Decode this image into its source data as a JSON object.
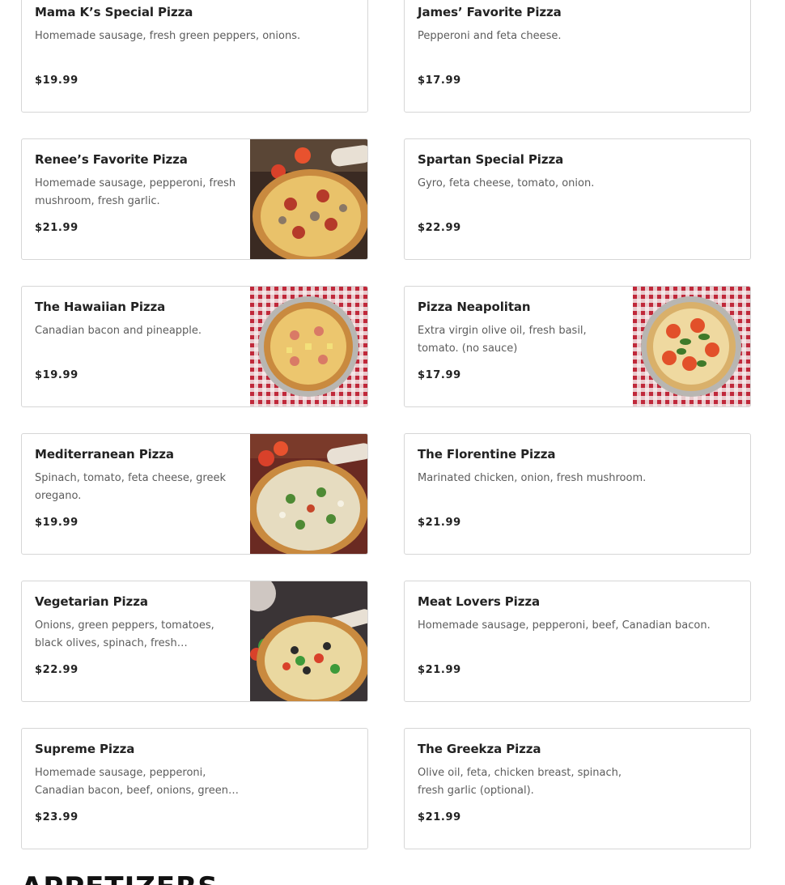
{
  "menu": {
    "items": [
      {
        "name": "Mama K’s Special Pizza",
        "description": "Homemade sausage, fresh green peppers, onions.",
        "price": "$19.99",
        "image": "none"
      },
      {
        "name": "James’ Favorite Pizza",
        "description": "Pepperoni and feta cheese.",
        "price": "$17.99",
        "image": "none"
      },
      {
        "name": "Renee’s Favorite Pizza",
        "description": "Homemade sausage, pepperoni, fresh mushroom, fresh garlic.",
        "price": "$21.99",
        "image": "pizza-pepperoni-mushroom-photo"
      },
      {
        "name": "Spartan Special Pizza",
        "description": "Gyro, feta cheese, tomato, onion.",
        "price": "$22.99",
        "image": "none"
      },
      {
        "name": "The Hawaiian Pizza",
        "description": "Canadian bacon and pineapple.",
        "price": "$19.99",
        "image": "pizza-hawaiian-photo"
      },
      {
        "name": "Pizza Neapolitan",
        "description": "Extra virgin olive oil, fresh basil, tomato. (no sauce)",
        "price": "$17.99",
        "image": "pizza-neapolitan-photo"
      },
      {
        "name": "Mediterranean Pizza",
        "description": "Spinach, tomato, feta cheese, greek oregano.",
        "price": "$19.99",
        "image": "pizza-mediterranean-photo"
      },
      {
        "name": "The Florentine Pizza",
        "description": "Marinated chicken, onion, fresh mushroom.",
        "price": "$21.99",
        "image": "none"
      },
      {
        "name": "Vegetarian Pizza",
        "description": "Onions, green peppers, tomatoes, black olives, spinach, fresh mushrooms.",
        "price": "$22.99",
        "image": "pizza-vegetarian-photo"
      },
      {
        "name": "Meat Lovers Pizza",
        "description": "Homemade sausage, pepperoni, beef, Canadian bacon.",
        "price": "$21.99",
        "image": "none"
      },
      {
        "name": "Supreme Pizza",
        "description": "Homemade sausage, pepperoni, Canadian bacon, beef, onions, green peppers, fresh mushrooms, black olives.",
        "price": "$23.99",
        "image": "none"
      },
      {
        "name": "The Greekza Pizza",
        "description": "Olive oil, feta, chicken breast, spinach, fresh garlic (optional).",
        "price": "$21.99",
        "image": "none"
      }
    ]
  },
  "next_section": {
    "title": "APPETIZERS"
  },
  "colors": {
    "border": "#d6d6d6",
    "text": "#222222",
    "muted": "#5c5c5c",
    "checker_red": "#c0283a"
  }
}
